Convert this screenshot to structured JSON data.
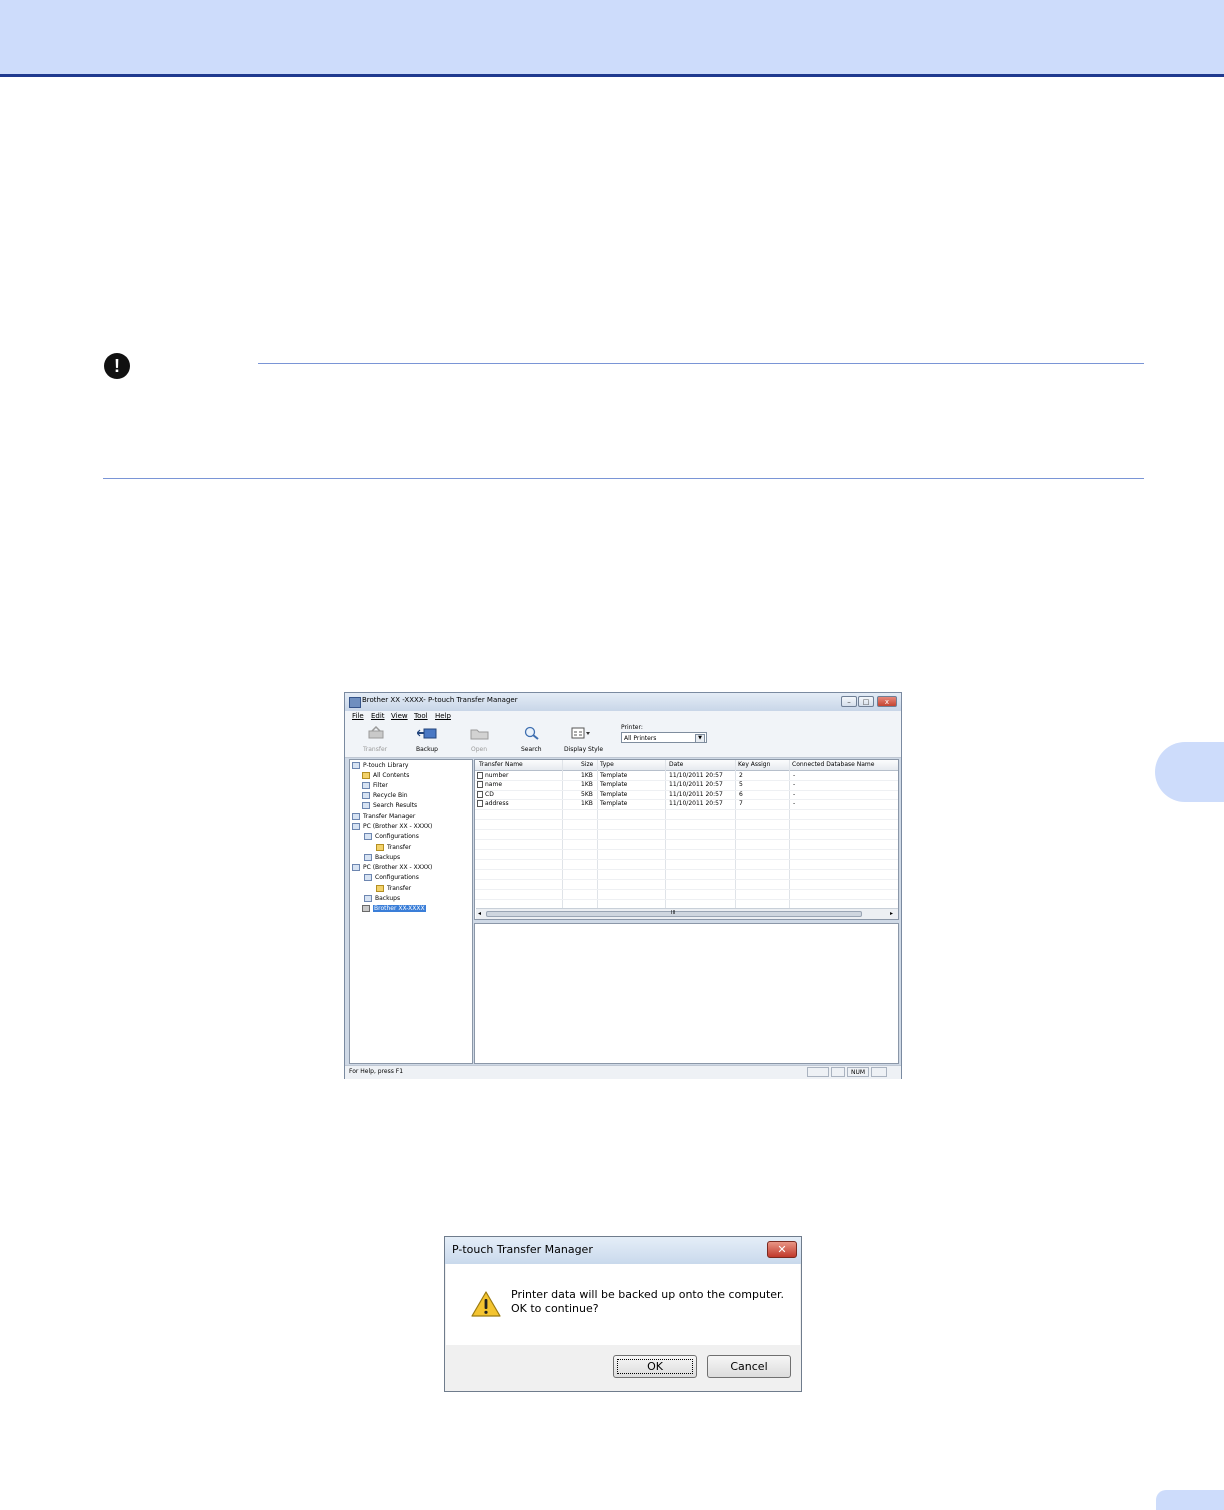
{
  "important_icon": "!",
  "app_window": {
    "title": "Brother XX -XXXX- P-touch Transfer Manager",
    "window_buttons": [
      "–",
      "□",
      "x"
    ],
    "menu": [
      "File",
      "Edit",
      "View",
      "Tool",
      "Help"
    ],
    "toolbar": {
      "transfer": "Transfer",
      "backup": "Backup",
      "open": "Open",
      "search": "Search",
      "display_style": "Display Style",
      "printer_label": "Printer:",
      "printer_value": "All Printers",
      "dropdown_arrow": "▼"
    },
    "tree": [
      "P-touch Library",
      "All Contents",
      "Filter",
      "Recycle Bin",
      "Search Results",
      "Transfer Manager",
      "PC (Brother XX - XXXX)",
      "Configurations",
      "Transfer",
      "Backups",
      "PC (Brother XX - XXXX)",
      "Configurations",
      "Transfer",
      "Backups",
      "Brother XX-XXXX"
    ],
    "columns": [
      "Transfer Name",
      "Size",
      "Type",
      "Date",
      "Key Assign",
      "Connected Database Name"
    ],
    "rows": [
      {
        "name": "number",
        "size": "1KB",
        "type": "Template",
        "date": "11/10/2011 20:57",
        "key": "2",
        "db": "-"
      },
      {
        "name": "name",
        "size": "1KB",
        "type": "Template",
        "date": "11/10/2011 20:57",
        "key": "5",
        "db": "-"
      },
      {
        "name": "CD",
        "size": "5KB",
        "type": "Template",
        "date": "11/10/2011 20:57",
        "key": "6",
        "db": "-"
      },
      {
        "name": "address",
        "size": "1KB",
        "type": "Template",
        "date": "11/10/2011 20:57",
        "key": "7",
        "db": "-"
      }
    ],
    "scroll_left": "◂",
    "scroll_right": "▸",
    "scroll_grip": "III",
    "status_text": "For Help, press F1",
    "status_num": "NUM"
  },
  "dialog": {
    "title": "P-touch Transfer Manager",
    "close": "✕",
    "message_line1": "Printer data will be backed up onto the computer.",
    "message_line2": "OK to continue?",
    "ok": "OK",
    "cancel": "Cancel"
  }
}
